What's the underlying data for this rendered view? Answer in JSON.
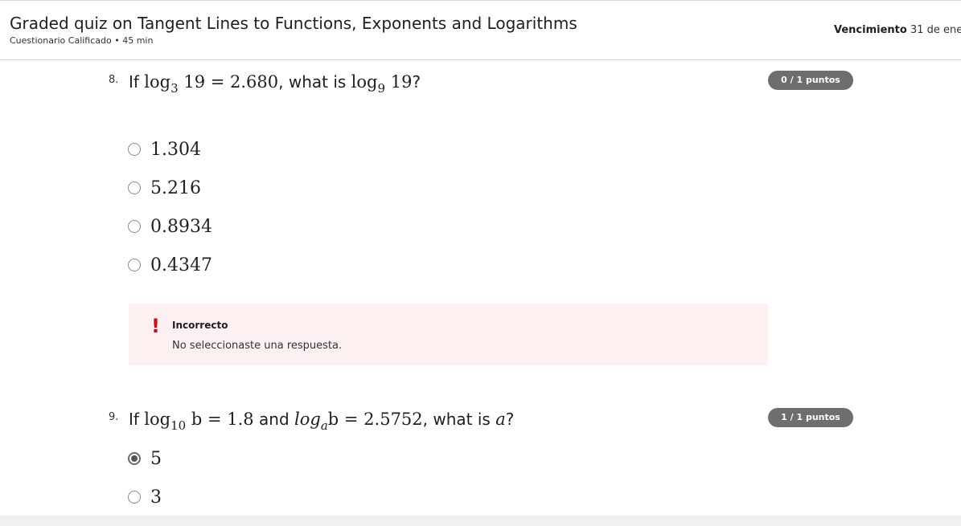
{
  "header": {
    "title": "Graded quiz on Tangent Lines to Functions, Exponents and Logarithms",
    "subtitle": "Cuestionario Calificado • 45 min",
    "due_label": "Vencimiento",
    "due_value": " 31 de ene"
  },
  "questions": [
    {
      "number": "8.",
      "text": {
        "p1": "If ",
        "log": "log",
        "base1": "3",
        "arg1": " 19 = 2.680",
        "p2": ", what is ",
        "log2": "log",
        "base2": "9",
        "arg2": " 19",
        "p3": "?"
      },
      "points": "0 / 1 puntos",
      "options": [
        {
          "label": "1.304",
          "selected": false
        },
        {
          "label": "5.216",
          "selected": false
        },
        {
          "label": "0.8934",
          "selected": false
        },
        {
          "label": "0.4347",
          "selected": false
        }
      ],
      "feedback": {
        "icon": "!",
        "title": "Incorrecto",
        "message": "No seleccionaste una respuesta."
      }
    },
    {
      "number": "9.",
      "text": {
        "p1": "If ",
        "log": "log",
        "base1": "10",
        "arg1": " b = 1.8",
        "p2": " and ",
        "log2": "log",
        "base2": "a",
        "arg2": "b = 2.5752",
        "p3": ", what is ",
        "var": "a",
        "p4": "?"
      },
      "points": "1 / 1 puntos",
      "options": [
        {
          "label": "5",
          "selected": true
        },
        {
          "label": "3",
          "selected": false
        }
      ]
    }
  ]
}
